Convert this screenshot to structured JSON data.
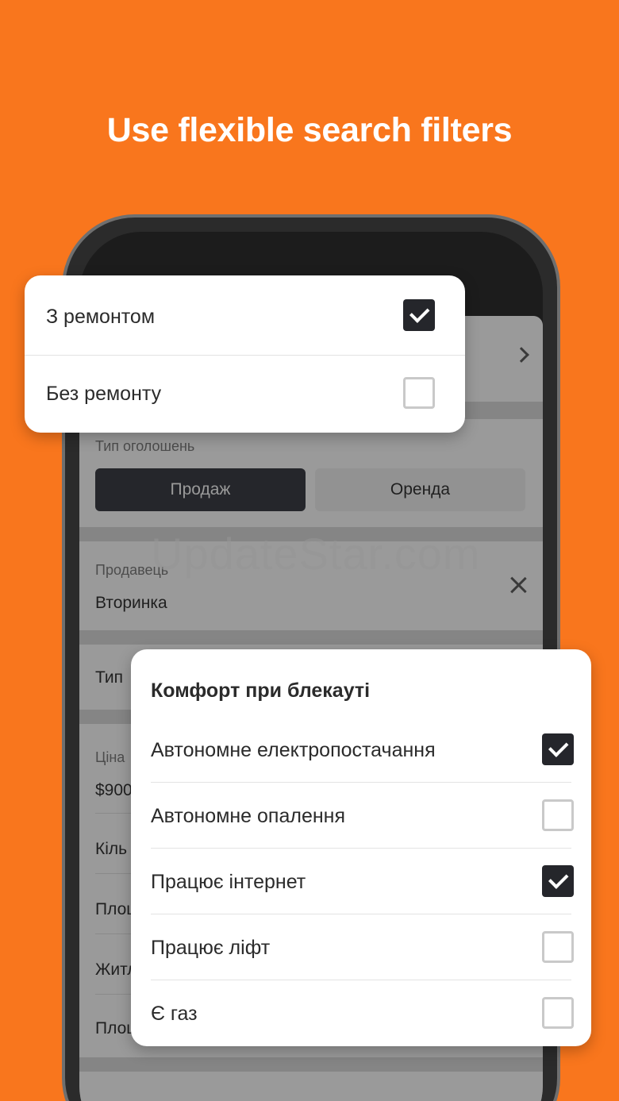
{
  "headline": "Use flexible search filters",
  "watermark": "UpdateStar.com",
  "screen": {
    "listing_type_label": "Тип оголошень",
    "listing_type_options": [
      "Продаж",
      "Оренда"
    ],
    "seller_label": "Продавець",
    "seller_value": "Вторинка",
    "object_type_label": "Тип",
    "price_label": "Ціна",
    "price_value": "$900",
    "rows": [
      "Кіль",
      "Площ",
      "Житл",
      "Площ"
    ]
  },
  "repair_popup": {
    "items": [
      {
        "label": "З ремонтом",
        "checked": true
      },
      {
        "label": "Без ремонту",
        "checked": false
      }
    ]
  },
  "blackout_popup": {
    "title": "Комфорт при блекауті",
    "items": [
      {
        "label": "Автономне електропостачання",
        "checked": true
      },
      {
        "label": "Автономне опалення",
        "checked": false
      },
      {
        "label": "Працює інтернет",
        "checked": true
      },
      {
        "label": "Працює ліфт",
        "checked": false
      },
      {
        "label": "Є газ",
        "checked": false
      }
    ]
  },
  "colors": {
    "background": "#F9761D",
    "accent_dark": "#25262B"
  },
  "icons": [
    "chevron-right-icon",
    "close-icon",
    "checkmark-icon"
  ]
}
